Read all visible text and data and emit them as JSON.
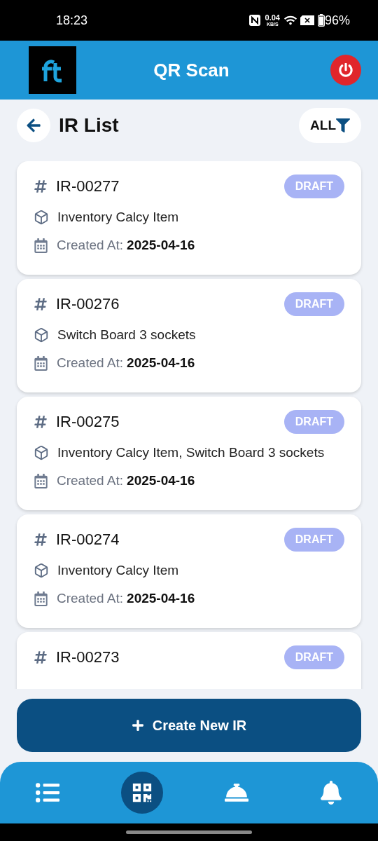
{
  "status_bar": {
    "time": "18:23",
    "net_speed": "0.04",
    "net_unit": "KB/S",
    "battery": "96%"
  },
  "app_bar": {
    "title": "QR Scan"
  },
  "page": {
    "title": "IR List",
    "filter": "ALL"
  },
  "records": [
    {
      "id": "IR-00277",
      "status": "DRAFT",
      "items": "Inventory Calcy Item",
      "date_label": "Created At:",
      "date": "2025-04-16"
    },
    {
      "id": "IR-00276",
      "status": "DRAFT",
      "items": "Switch Board 3 sockets",
      "date_label": "Created At:",
      "date": "2025-04-16"
    },
    {
      "id": "IR-00275",
      "status": "DRAFT",
      "items": "Inventory Calcy Item, Switch Board 3 sockets",
      "date_label": "Created At:",
      "date": "2025-04-16"
    },
    {
      "id": "IR-00274",
      "status": "DRAFT",
      "items": "Inventory Calcy Item",
      "date_label": "Created At:",
      "date": "2025-04-16"
    },
    {
      "id": "IR-00273",
      "status": "DRAFT"
    }
  ],
  "create_button": "Create New IR",
  "bottom_nav": [
    {
      "kind": "list",
      "selected": false
    },
    {
      "kind": "qr",
      "selected": true
    },
    {
      "kind": "service",
      "selected": false
    },
    {
      "kind": "bell",
      "selected": false
    }
  ]
}
